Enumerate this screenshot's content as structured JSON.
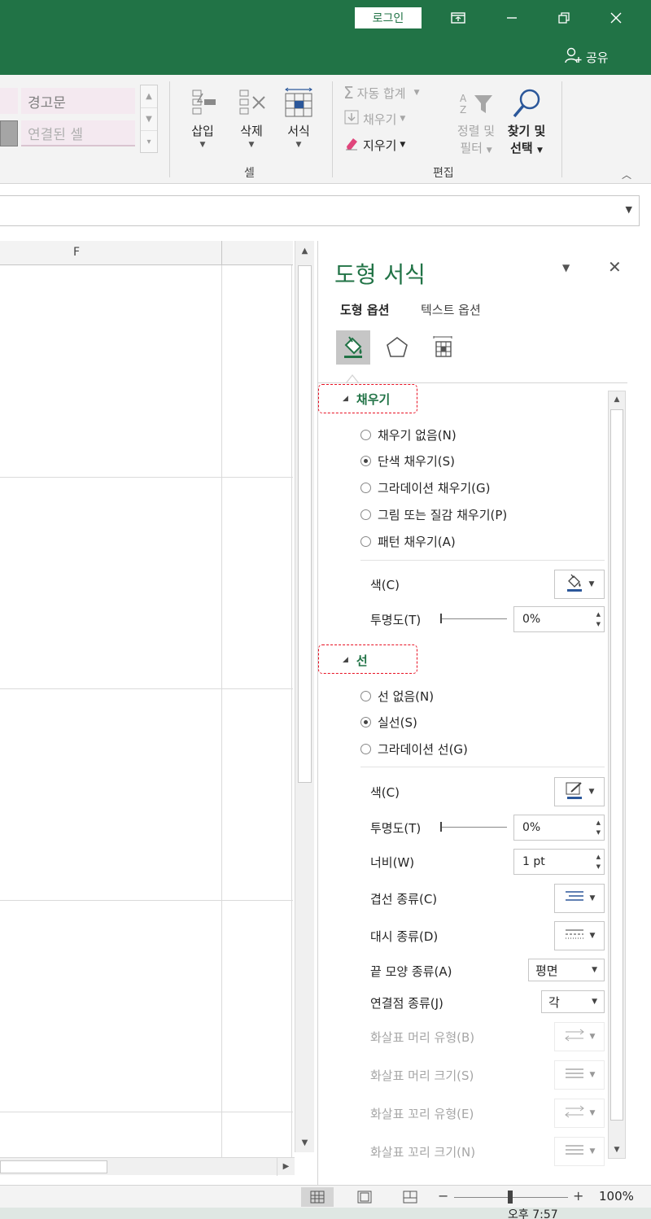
{
  "titlebar": {
    "login_label": "로그인",
    "share_label": "공유"
  },
  "ribbon": {
    "styles": {
      "warning_text": "경고문",
      "linked_cell": "연결된 셀"
    },
    "cells_group": {
      "label": "셀",
      "insert": "삽입",
      "delete": "삭제",
      "format": "서식"
    },
    "editing_group": {
      "label": "편집",
      "autosum": "자동 합계",
      "fill": "채우기",
      "clear": "지우기",
      "sort_filter_line1": "정렬 및",
      "sort_filter_line2": "필터",
      "find_select_line1": "찾기 및",
      "find_select_line2": "선택"
    }
  },
  "sheet": {
    "column_f": "F"
  },
  "pane": {
    "title": "도형 서식",
    "tabs": [
      "도형 옵션",
      "텍스트 옵션"
    ],
    "fill": {
      "heading": "채우기",
      "options": [
        {
          "label": "채우기 없음(N)",
          "selected": false
        },
        {
          "label": "단색 채우기(S)",
          "selected": true
        },
        {
          "label": "그라데이션 채우기(G)",
          "selected": false
        },
        {
          "label": "그림 또는 질감 채우기(P)",
          "selected": false
        },
        {
          "label": "패턴 채우기(A)",
          "selected": false
        }
      ],
      "color_label": "색(C)",
      "transparency_label": "투명도(T)",
      "transparency_value": "0%"
    },
    "line": {
      "heading": "선",
      "options": [
        {
          "label": "선 없음(N)",
          "selected": false
        },
        {
          "label": "실선(S)",
          "selected": true
        },
        {
          "label": "그라데이션 선(G)",
          "selected": false
        }
      ],
      "color_label": "색(C)",
      "transparency_label": "투명도(T)",
      "transparency_value": "0%",
      "width_label": "너비(W)",
      "width_value": "1 pt",
      "compound_label": "겹선 종류(C)",
      "dash_label": "대시 종류(D)",
      "cap_label": "끝 모양 종류(A)",
      "cap_value": "평면",
      "join_label": "연결점 종류(J)",
      "join_value": "각",
      "begin_arrow_type_label": "화살표 머리 유형(B)",
      "begin_arrow_size_label": "화살표 머리 크기(S)",
      "end_arrow_type_label": "화살표 꼬리 유형(E)",
      "end_arrow_size_label": "화살표 꼬리 크기(N)"
    }
  },
  "statusbar": {
    "zoom": "100%"
  },
  "taskbar": {
    "clock": "오후 7:57"
  },
  "colors": {
    "excel_green": "#217346",
    "highlight_red": "#e81123",
    "fill_swatch": "#2b579a"
  }
}
